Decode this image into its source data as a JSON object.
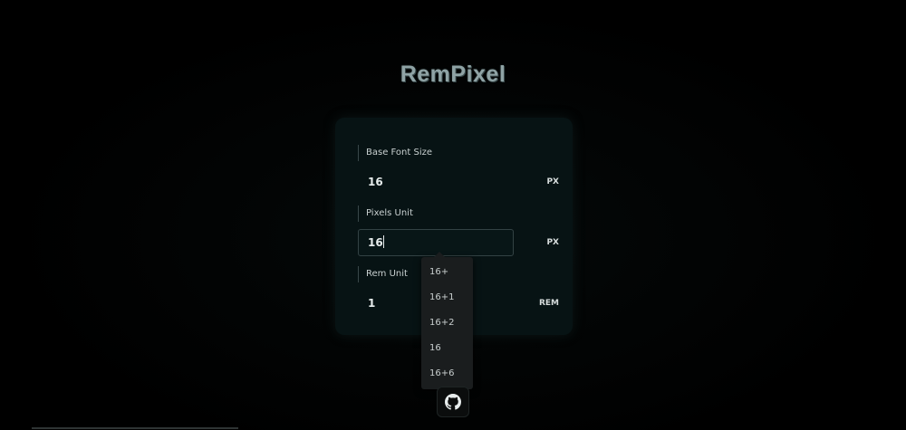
{
  "app": {
    "title": "RemPixel"
  },
  "fields": {
    "base_font_size": {
      "label": "Base Font Size",
      "value": "16",
      "unit": "PX"
    },
    "pixels_unit": {
      "label": "Pixels Unit",
      "value": "16",
      "unit": "PX"
    },
    "rem_unit": {
      "label": "Rem Unit",
      "value": "1",
      "unit": "REM"
    }
  },
  "suggestions": [
    "16+",
    "16+1",
    "16+2",
    "16",
    "16+6"
  ],
  "footer": {
    "github_icon": "github-icon"
  },
  "colors": {
    "background": "#000000",
    "card": "#071314",
    "title": "#8fa3a5",
    "dropdown": "#1a1d1e"
  }
}
